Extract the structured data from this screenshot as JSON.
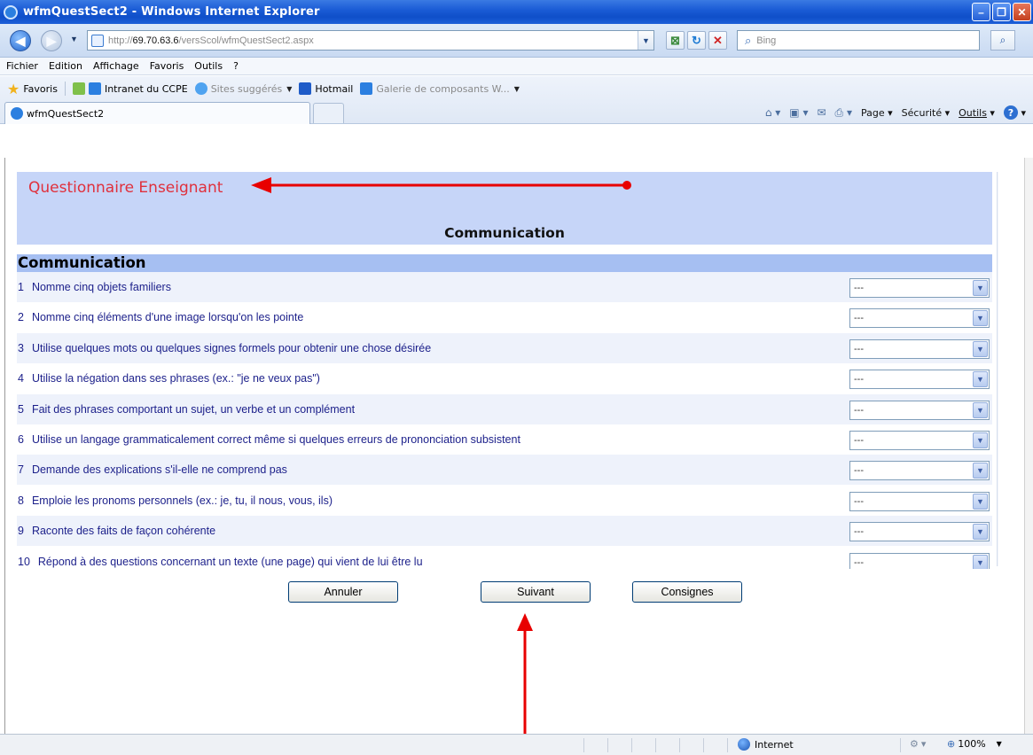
{
  "window": {
    "title": "wfmQuestSect2 - Windows Internet Explorer"
  },
  "address": {
    "url_prefix": "http://",
    "url_host": "69.70.63.6",
    "url_path": "/versScol/wfmQuestSect2.aspx",
    "search_placeholder": "Bing"
  },
  "menu": [
    "Fichier",
    "Edition",
    "Affichage",
    "Favoris",
    "Outils",
    "?"
  ],
  "favorites": {
    "label": "Favoris",
    "items": [
      "Intranet du CCPE",
      "Sites suggérés",
      "Hotmail",
      "Galerie de composants W..."
    ]
  },
  "tab": {
    "title": "wfmQuestSect2"
  },
  "commandbar": {
    "page": "Page",
    "security": "Sécurité",
    "tools": "Outils"
  },
  "page": {
    "questionnaire_title": "Questionnaire Enseignant",
    "section_heading": "Communication",
    "section_label": "Communication",
    "questions": [
      {
        "num": "1",
        "text": "Nomme cinq objets familiers",
        "value": "---"
      },
      {
        "num": "2",
        "text": "Nomme cinq éléments d'une image lorsqu'on les pointe",
        "value": "---"
      },
      {
        "num": "3",
        "text": "Utilise quelques mots ou quelques signes formels pour obtenir une chose désirée",
        "value": "---"
      },
      {
        "num": "4",
        "text": "Utilise la négation dans ses phrases (ex.: \"je ne veux pas\")",
        "value": "---"
      },
      {
        "num": "5",
        "text": "Fait des phrases comportant un sujet, un verbe et un complément",
        "value": "---"
      },
      {
        "num": "6",
        "text": "Utilise un langage grammaticalement correct même si quelques erreurs de prononciation subsistent",
        "value": "---"
      },
      {
        "num": "7",
        "text": "Demande des explications s'il-elle ne comprend pas",
        "value": "---"
      },
      {
        "num": "8",
        "text": "Emploie les pronoms personnels (ex.: je, tu, il nous, vous, ils)",
        "value": "---"
      },
      {
        "num": "9",
        "text": "Raconte des faits de façon cohérente",
        "value": "---"
      },
      {
        "num": "10",
        "text": "Répond à des questions concernant un texte (une page) qui vient de lui être lu",
        "value": "---"
      }
    ],
    "buttons": {
      "cancel": "Annuler",
      "next": "Suivant",
      "instructions": "Consignes"
    }
  },
  "status": {
    "zone": "Internet",
    "zoom": "100%"
  },
  "colors": {
    "title_red": "#e0303c",
    "header_blue": "#c6d5f8",
    "section_blue": "#a6bff2",
    "question_text": "#1b1f8a",
    "annotation_arrow": "#e80000"
  }
}
